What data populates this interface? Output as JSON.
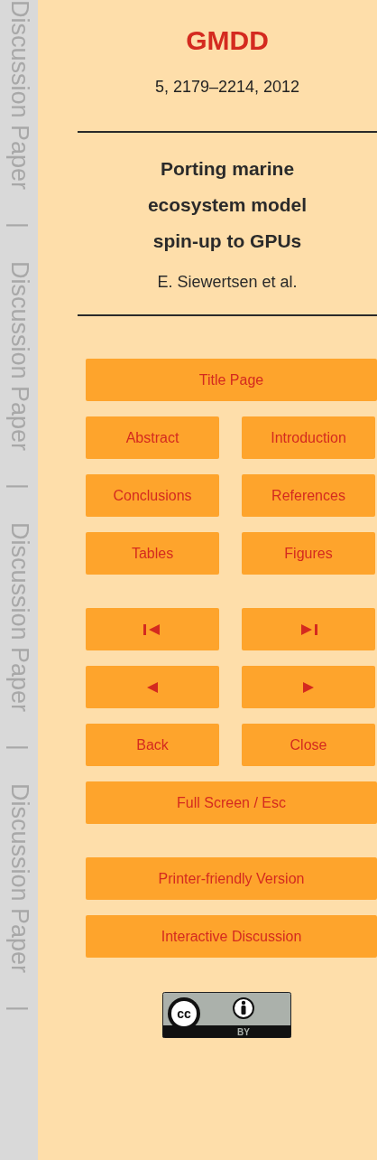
{
  "margin_labels": [
    {
      "kind": "label",
      "text": "Discussion Paper"
    },
    {
      "kind": "separator",
      "text": "|"
    },
    {
      "kind": "label",
      "text": "Discussion Paper"
    },
    {
      "kind": "separator",
      "text": "|"
    },
    {
      "kind": "label",
      "text": "Discussion Paper"
    },
    {
      "kind": "separator",
      "text": "|"
    },
    {
      "kind": "label",
      "text": "Discussion Paper"
    },
    {
      "kind": "separator",
      "text": "|"
    }
  ],
  "journal": "GMDD",
  "citation": "5, 2179–2214, 2012",
  "title": "Porting marine ecosystem model spin-up to GPUs",
  "authors": "E. Siewertsen et al.",
  "button_groups": [
    [
      [
        {
          "kind": "text",
          "label": "Title Page"
        }
      ],
      [
        {
          "kind": "text",
          "label": "Abstract"
        },
        {
          "kind": "text",
          "label": "Introduction"
        }
      ],
      [
        {
          "kind": "text",
          "label": "Conclusions"
        },
        {
          "kind": "text",
          "label": "References"
        }
      ],
      [
        {
          "kind": "text",
          "label": "Tables"
        },
        {
          "kind": "text",
          "label": "Figures"
        }
      ]
    ],
    [
      [
        {
          "kind": "first"
        },
        {
          "kind": "last"
        }
      ],
      [
        {
          "kind": "prev"
        },
        {
          "kind": "next"
        }
      ],
      [
        {
          "kind": "text",
          "label": "Back"
        },
        {
          "kind": "text",
          "label": "Close"
        }
      ],
      [
        {
          "kind": "text",
          "label": "Full Screen / Esc"
        }
      ]
    ],
    [
      [
        {
          "kind": "text",
          "label": "Printer-friendly Version"
        }
      ],
      [
        {
          "kind": "text",
          "label": "Interactive Discussion"
        }
      ]
    ]
  ],
  "license_badge": {
    "symbol": "cc",
    "label": "BY"
  }
}
